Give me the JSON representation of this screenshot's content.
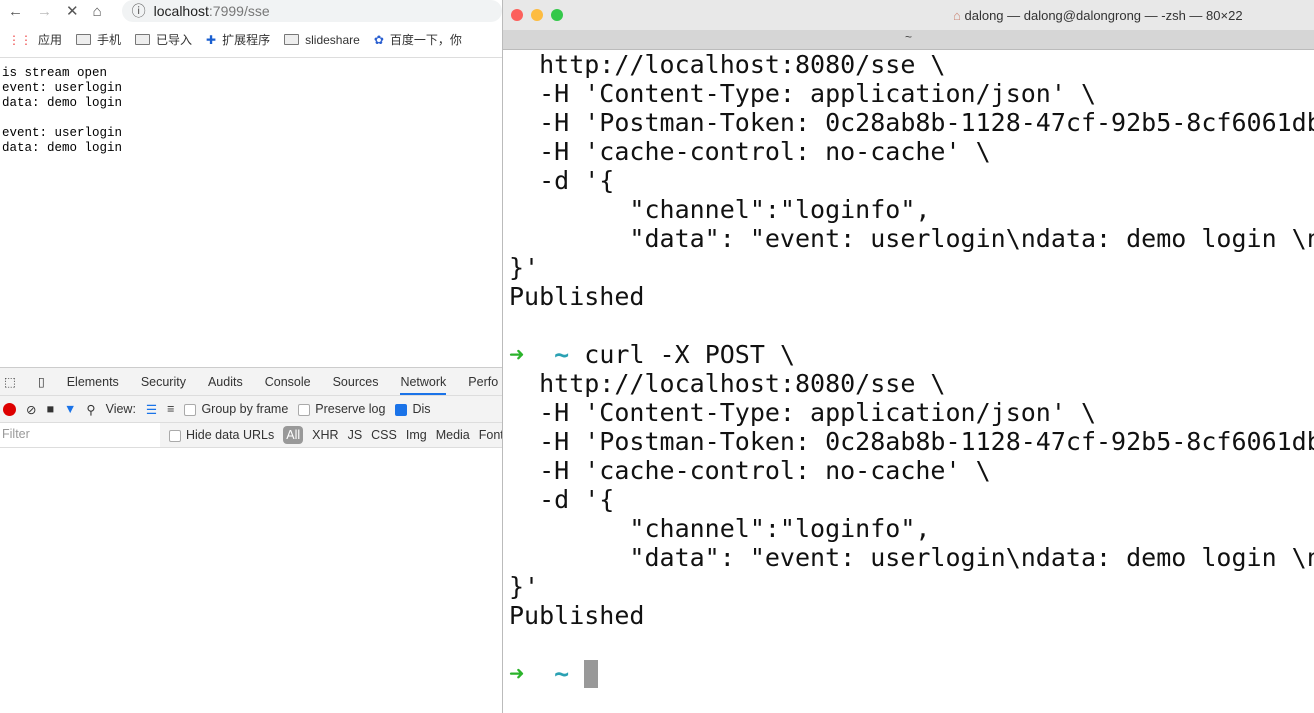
{
  "browser": {
    "url_host": "localhost",
    "url_rest": ":7999/sse",
    "bookmarks": [
      "应用",
      "手机",
      "已导入",
      "扩展程序",
      "slideshare",
      "百度一下，你"
    ],
    "content": "is stream open\nevent: userlogin\ndata: demo login\n\nevent: userlogin\ndata: demo login"
  },
  "devtools": {
    "tabs": [
      "Elements",
      "Security",
      "Audits",
      "Console",
      "Sources",
      "Network",
      "Perfo"
    ],
    "active_tab": "Network",
    "view_label": "View:",
    "group_by_frame": "Group by frame",
    "preserve_log": "Preserve log",
    "disable_cache": "Dis",
    "filter_placeholder": "Filter",
    "hide_data_urls": "Hide data URLs",
    "types": [
      "All",
      "XHR",
      "JS",
      "CSS",
      "Img",
      "Media",
      "Font"
    ]
  },
  "terminal": {
    "title": "dalong — dalong@dalongrong — -zsh — 80×22",
    "tab": "~",
    "lines": [
      "  http://localhost:8080/sse \\",
      "  -H 'Content-Type: application/json' \\",
      "  -H 'Postman-Token: 0c28ab8b-1128-47cf-92b5-8cf6061db",
      "  -H 'cache-control: no-cache' \\",
      "  -d '{",
      "        \"channel\":\"loginfo\",",
      "        \"data\": \"event: userlogin\\ndata: demo login \\n",
      "}'",
      "Published",
      ""
    ],
    "cmd": "curl -X POST \\",
    "lines2": [
      "  http://localhost:8080/sse \\",
      "  -H 'Content-Type: application/json' \\",
      "  -H 'Postman-Token: 0c28ab8b-1128-47cf-92b5-8cf6061db",
      "  -H 'cache-control: no-cache' \\",
      "  -d '{",
      "        \"channel\":\"loginfo\",",
      "        \"data\": \"event: userlogin\\ndata: demo login \\n",
      "}'",
      "Published",
      ""
    ],
    "prompt_arrow": "➜",
    "prompt_dir": "~",
    "colors": {
      "arrow": "#2bb32b",
      "dir": "#2aa1b3"
    }
  }
}
